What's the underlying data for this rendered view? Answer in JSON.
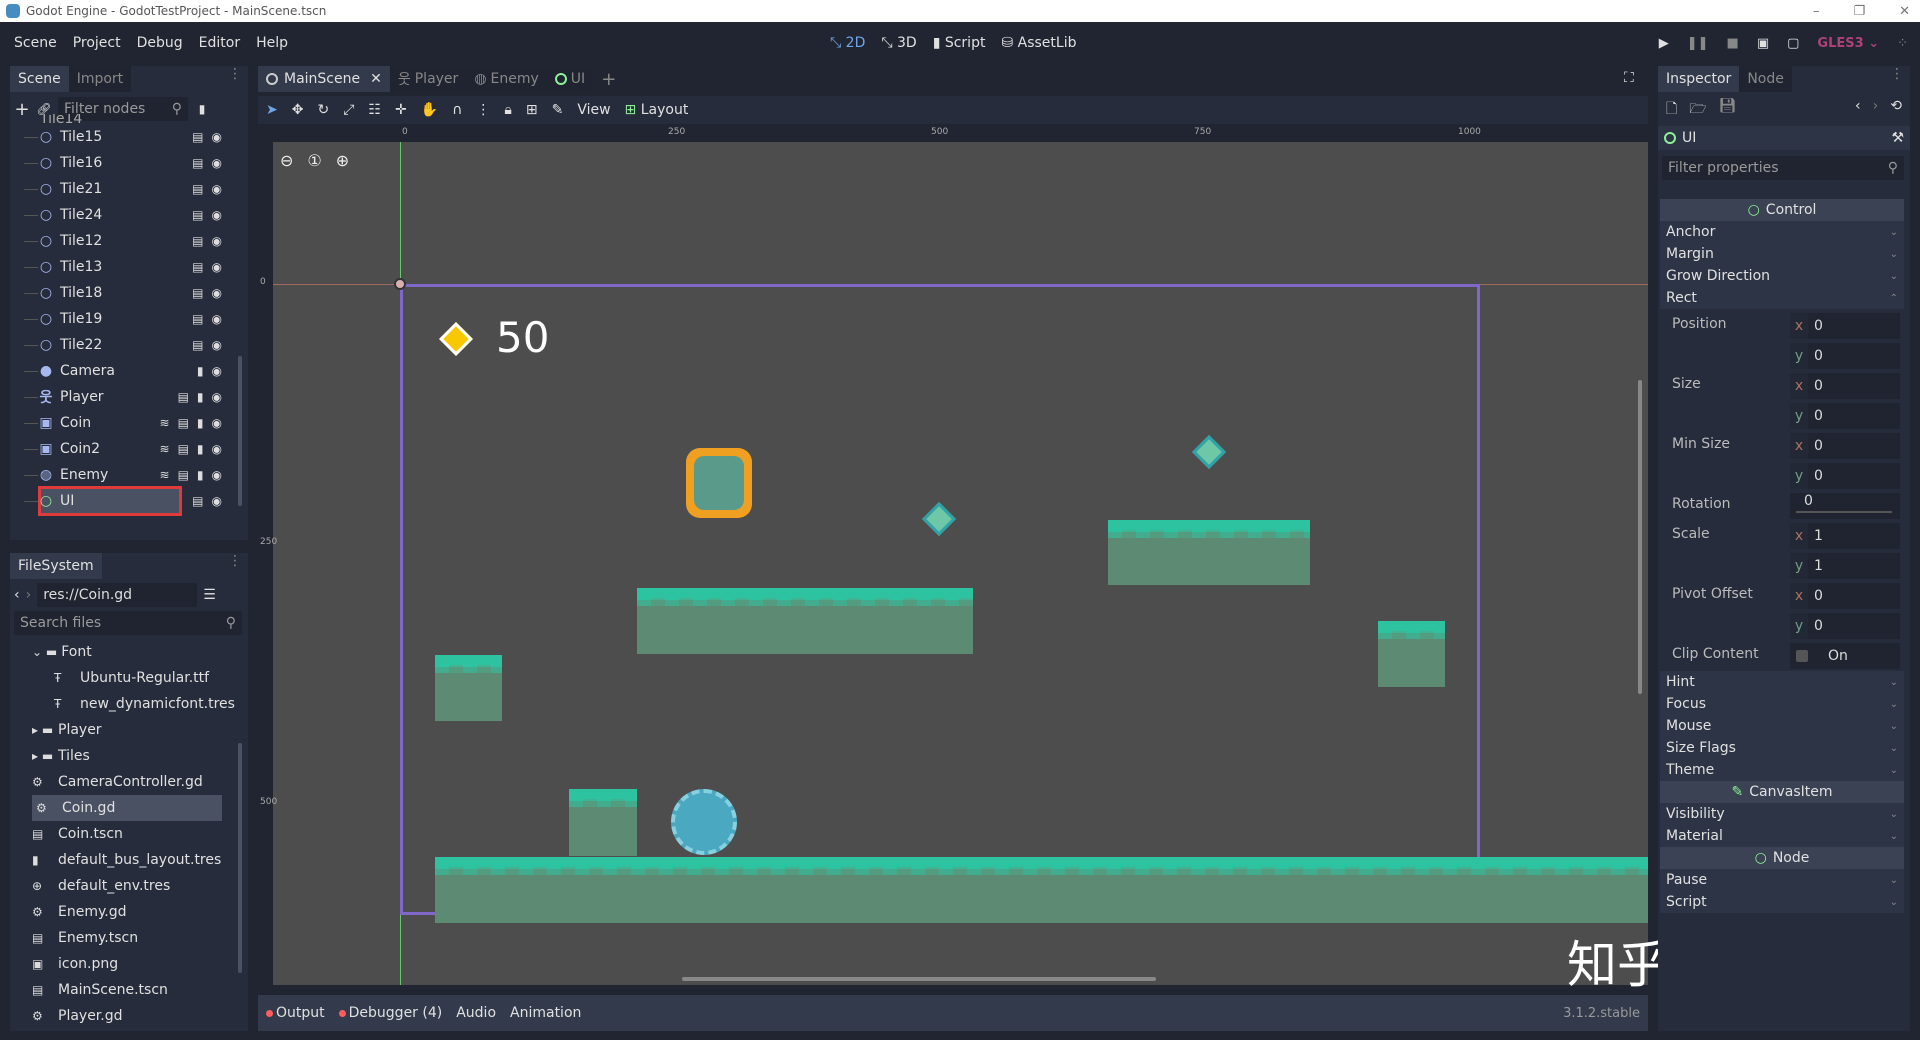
{
  "window": {
    "title": "Godot Engine - GodotTestProject - MainScene.tscn",
    "controls": [
      "–",
      "❐",
      "✕"
    ]
  },
  "menu": [
    "Scene",
    "Project",
    "Debug",
    "Editor",
    "Help"
  ],
  "modes": [
    {
      "label": "2D",
      "icon": "2d-icon"
    },
    {
      "label": "3D",
      "icon": "3d-icon"
    },
    {
      "label": "Script",
      "icon": "script-icon"
    },
    {
      "label": "AssetLib",
      "icon": "assetlib-icon"
    }
  ],
  "renderer": "GLES3",
  "scene_dock": {
    "tabs": [
      "Scene",
      "Import"
    ],
    "filter_placeholder": "Filter nodes",
    "nodes": [
      {
        "name": "Tile15",
        "type": "tile",
        "icons": "inst"
      },
      {
        "name": "Tile16",
        "type": "tile",
        "icons": "inst"
      },
      {
        "name": "Tile21",
        "type": "tile",
        "icons": "inst"
      },
      {
        "name": "Tile24",
        "type": "tile",
        "icons": "inst"
      },
      {
        "name": "Tile12",
        "type": "tile",
        "icons": "inst"
      },
      {
        "name": "Tile13",
        "type": "tile",
        "icons": "inst"
      },
      {
        "name": "Tile18",
        "type": "tile",
        "icons": "inst"
      },
      {
        "name": "Tile19",
        "type": "tile",
        "icons": "inst"
      },
      {
        "name": "Tile22",
        "type": "tile",
        "icons": "inst"
      },
      {
        "name": "Camera",
        "type": "camera",
        "icons": "script"
      },
      {
        "name": "Player",
        "type": "player",
        "icons": "inst-script"
      },
      {
        "name": "Coin",
        "type": "area",
        "icons": "sig-inst-script"
      },
      {
        "name": "Coin2",
        "type": "area",
        "icons": "sig-inst-script"
      },
      {
        "name": "Enemy",
        "type": "enemy",
        "icons": "sig-inst-script"
      },
      {
        "name": "UI",
        "type": "control",
        "icons": "inst",
        "selected": true
      }
    ]
  },
  "filesystem": {
    "tab": "FileSystem",
    "path": "res://Coin.gd",
    "search_placeholder": "Search files",
    "items": [
      {
        "name": "Font",
        "kind": "folder-open",
        "depth": 1
      },
      {
        "name": "Ubuntu-Regular.ttf",
        "kind": "font",
        "depth": 2
      },
      {
        "name": "new_dynamicfont.tres",
        "kind": "font",
        "depth": 2
      },
      {
        "name": "Player",
        "kind": "folder",
        "depth": 1
      },
      {
        "name": "Tiles",
        "kind": "folder",
        "depth": 1
      },
      {
        "name": "CameraController.gd",
        "kind": "gd",
        "depth": 1
      },
      {
        "name": "Coin.gd",
        "kind": "gd",
        "depth": 1,
        "selected": true
      },
      {
        "name": "Coin.tscn",
        "kind": "scene",
        "depth": 1
      },
      {
        "name": "default_bus_layout.tres",
        "kind": "bus",
        "depth": 1
      },
      {
        "name": "default_env.tres",
        "kind": "env",
        "depth": 1
      },
      {
        "name": "Enemy.gd",
        "kind": "gd",
        "depth": 1
      },
      {
        "name": "Enemy.tscn",
        "kind": "scene",
        "depth": 1
      },
      {
        "name": "icon.png",
        "kind": "png",
        "depth": 1
      },
      {
        "name": "MainScene.tscn",
        "kind": "scene",
        "depth": 1
      },
      {
        "name": "Player.gd",
        "kind": "gd",
        "depth": 1
      }
    ]
  },
  "editor": {
    "tabs": [
      {
        "label": "MainScene",
        "active": true
      },
      {
        "label": "Player"
      },
      {
        "label": "Enemy"
      },
      {
        "label": "UI"
      }
    ],
    "toolbar": {
      "view": "View",
      "layout": "Layout"
    },
    "ruler": {
      "x": [
        "0",
        "250",
        "500",
        "750",
        "1000"
      ],
      "y": [
        "0",
        "250",
        "500"
      ]
    },
    "hud": {
      "coin_count": "50"
    }
  },
  "bottom": {
    "output": "Output",
    "debugger": "Debugger (4)",
    "audio": "Audio",
    "animation": "Animation",
    "version": "3.1.2.stable"
  },
  "inspector": {
    "tabs": [
      "Inspector",
      "Node"
    ],
    "node": "UI",
    "filter_placeholder": "Filter properties",
    "control": "Control",
    "groups1": [
      "Anchor",
      "Margin",
      "Grow Direction",
      "Rect"
    ],
    "props": [
      {
        "label": "Position",
        "x": "0",
        "y": "0"
      },
      {
        "label": "Size",
        "x": "0",
        "y": "0"
      },
      {
        "label": "Min Size",
        "x": "0",
        "y": "0"
      },
      {
        "label": "Rotation",
        "value": "0"
      },
      {
        "label": "Scale",
        "x": "1",
        "y": "1"
      },
      {
        "label": "Pivot Offset",
        "x": "0",
        "y": "0"
      },
      {
        "label": "Clip Content",
        "value": "On"
      }
    ],
    "groups2": [
      "Hint",
      "Focus",
      "Mouse",
      "Size Flags",
      "Theme"
    ],
    "canvasitem": "CanvasItem",
    "groups3": [
      "Visibility",
      "Material"
    ],
    "node_section": "Node",
    "groups4": [
      "Pause",
      "Script"
    ]
  },
  "watermark": "知乎 @唯一"
}
